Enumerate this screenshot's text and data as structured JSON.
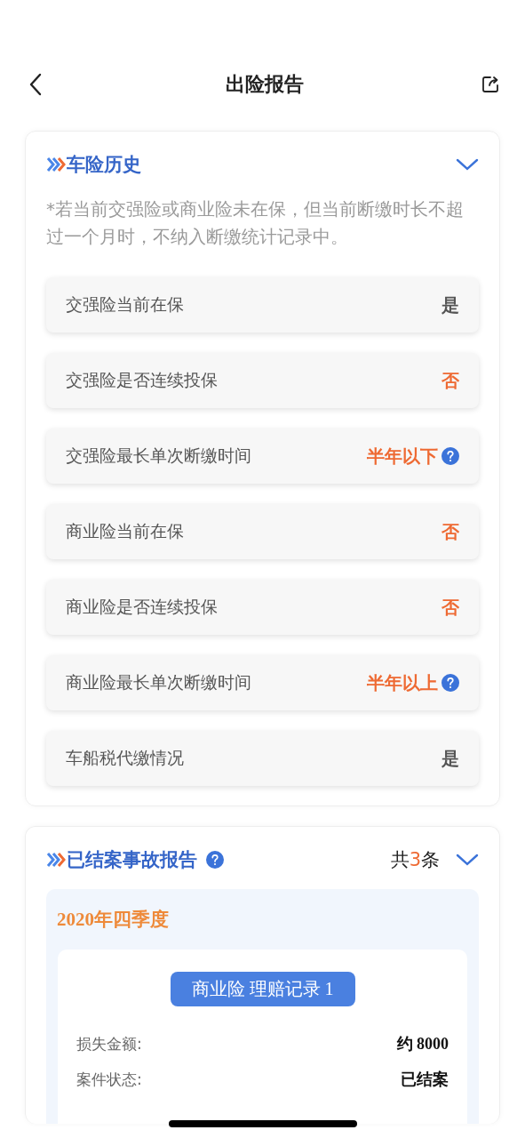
{
  "header": {
    "title": "出险报告"
  },
  "history": {
    "title": "车险历史",
    "expanded": true,
    "note": "*若当前交强险或商业险未在保，但当前断缴时长不超过一个月时，不纳入断缴统计记录中。",
    "rows": [
      {
        "label": "交强险当前在保",
        "value": "是",
        "color": "#555555",
        "help": false
      },
      {
        "label": "交强险是否连续投保",
        "value": "否",
        "color": "#ee6a33",
        "help": false
      },
      {
        "label": "交强险最长单次断缴时间",
        "value": "半年以下",
        "color": "#ee6a33",
        "help": true
      },
      {
        "label": "商业险当前在保",
        "value": "否",
        "color": "#ee6a33",
        "help": false
      },
      {
        "label": "商业险是否连续投保",
        "value": "否",
        "color": "#ee6a33",
        "help": false
      },
      {
        "label": "商业险最长单次断缴时间",
        "value": "半年以上",
        "color": "#ee6a33",
        "help": true
      },
      {
        "label": "车船税代缴情况",
        "value": "是",
        "color": "#555555",
        "help": false
      }
    ]
  },
  "accidents": {
    "title": "已结案事故报告",
    "expanded": true,
    "count_prefix": "共",
    "count": "3",
    "count_suffix": "条",
    "quarter": "2020年四季度",
    "record": {
      "title": "商业险 理赔记录 1",
      "fields": [
        {
          "label": "损失金额:",
          "value": "约 8000"
        },
        {
          "label": "案件状态:",
          "value": "已结案"
        }
      ]
    }
  }
}
